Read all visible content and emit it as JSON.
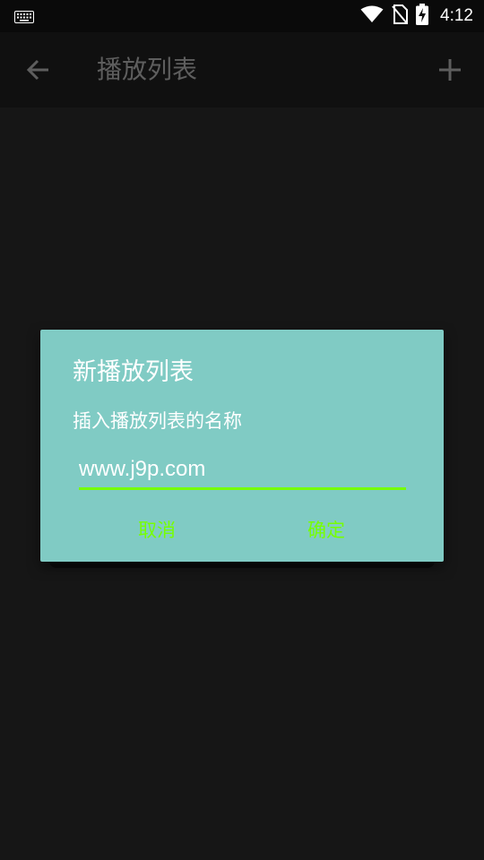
{
  "status_bar": {
    "time": "4:12",
    "icons": [
      "keyboard-icon",
      "wifi-icon",
      "no-sim-icon",
      "battery-charging-icon"
    ]
  },
  "toolbar": {
    "title": "播放列表",
    "back_icon": "arrow-left-icon",
    "add_icon": "plus-icon"
  },
  "dialog": {
    "title": "新播放列表",
    "message": "插入播放列表的名称",
    "input_value": "www.j9p.com",
    "cancel_label": "取消",
    "ok_label": "确定",
    "accent_color": "#76ff03",
    "background_color": "#80cbc4"
  },
  "colors": {
    "page_background": "#161616",
    "toolbar_background": "#101010",
    "status_bar_background": "#0a0a0a"
  }
}
